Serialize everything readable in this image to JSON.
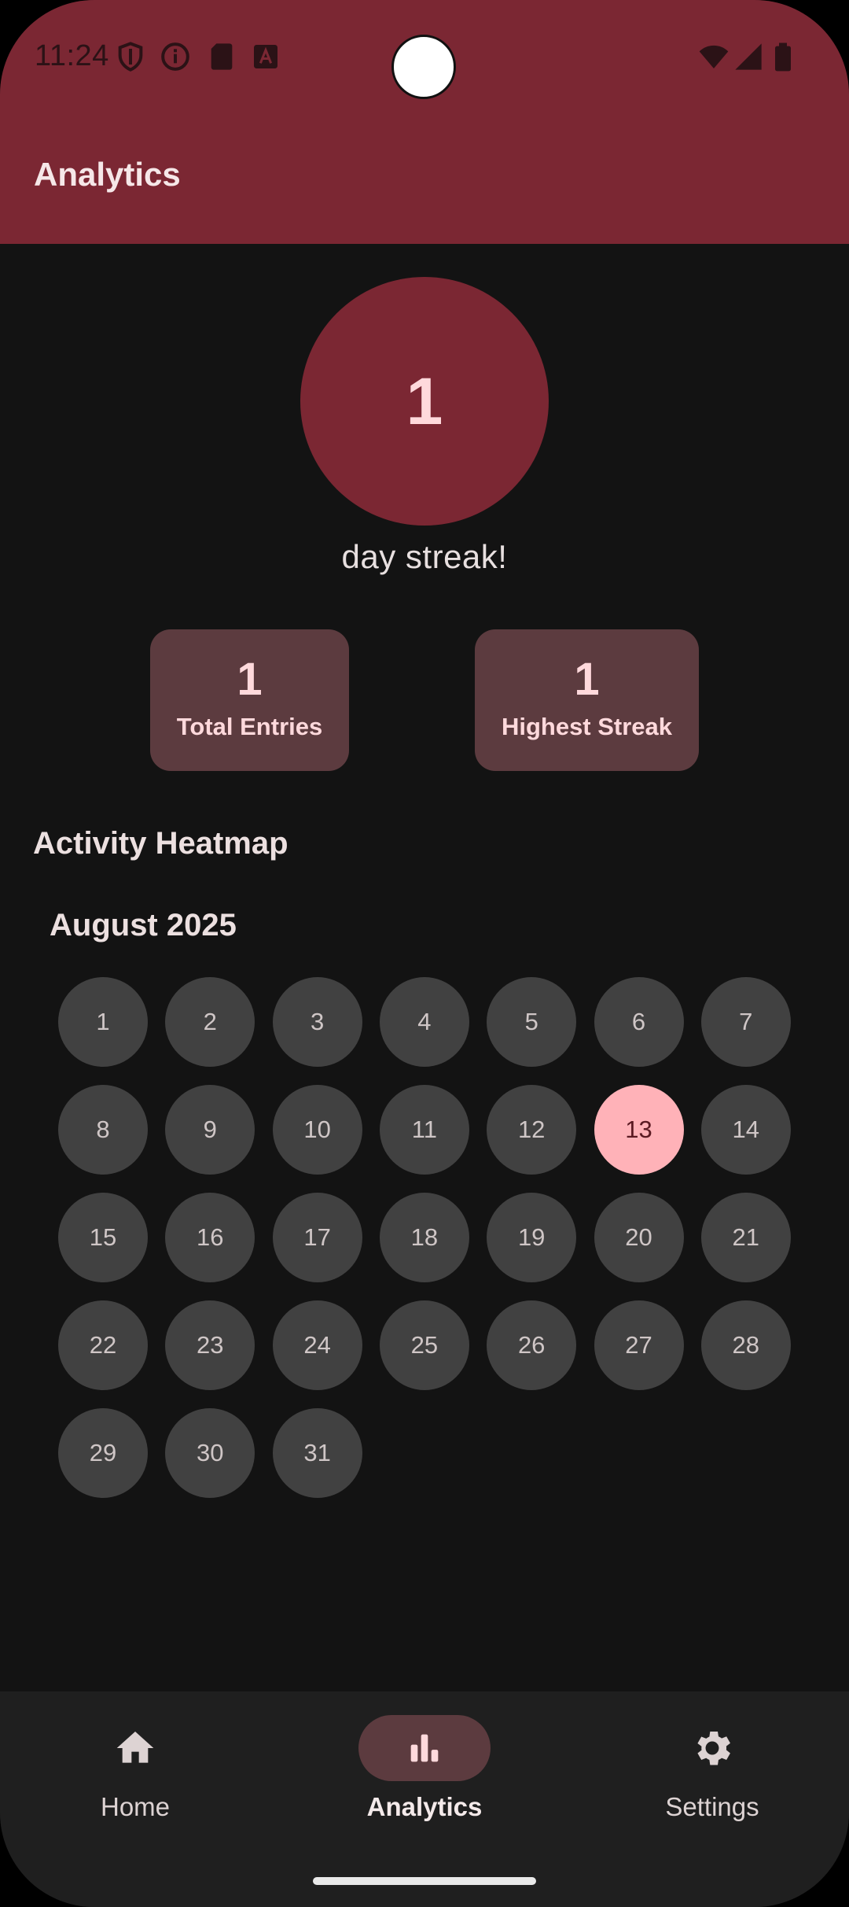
{
  "status_bar": {
    "time": "11:24"
  },
  "header": {
    "title": "Analytics"
  },
  "streak": {
    "count": "1",
    "label": "day streak!"
  },
  "stats": [
    {
      "value": "1",
      "label": "Total Entries"
    },
    {
      "value": "1",
      "label": "Highest Streak"
    }
  ],
  "heatmap": {
    "section_title": "Activity Heatmap",
    "month": "August 2025",
    "days": [
      "1",
      "2",
      "3",
      "4",
      "5",
      "6",
      "7",
      "8",
      "9",
      "10",
      "11",
      "12",
      "13",
      "14",
      "15",
      "16",
      "17",
      "18",
      "19",
      "20",
      "21",
      "22",
      "23",
      "24",
      "25",
      "26",
      "27",
      "28",
      "29",
      "30",
      "31"
    ],
    "active_day": "13"
  },
  "nav": {
    "items": [
      {
        "label": "Home",
        "icon": "home-icon"
      },
      {
        "label": "Analytics",
        "icon": "bar-chart-icon",
        "selected": true
      },
      {
        "label": "Settings",
        "icon": "gear-icon"
      }
    ]
  },
  "colors": {
    "accent": "#7b2733",
    "active_day": "#ffb2b8",
    "card": "#5c3b3f",
    "background": "#131313"
  }
}
